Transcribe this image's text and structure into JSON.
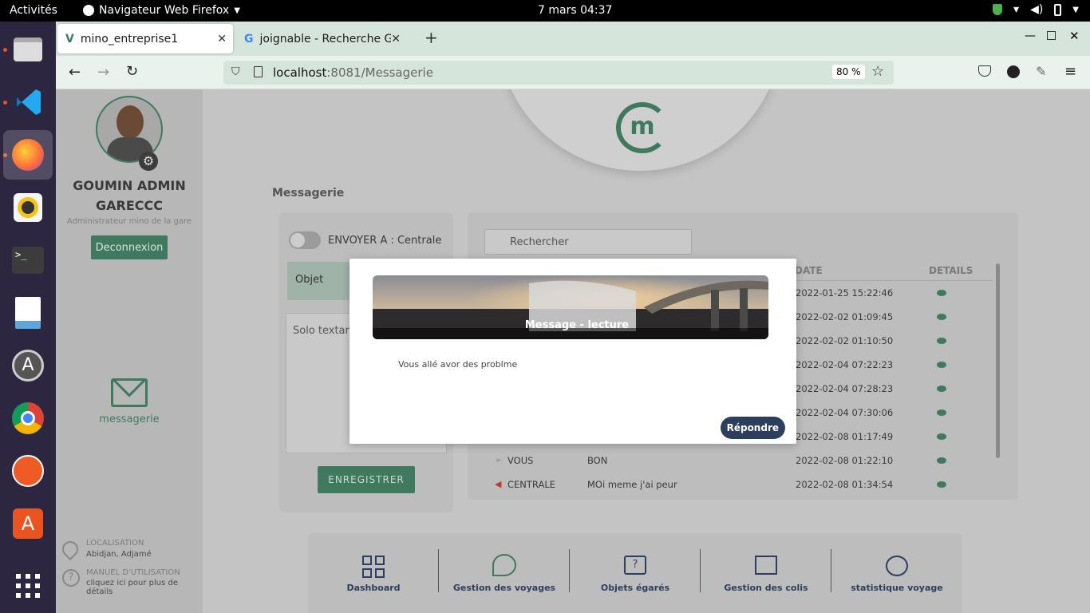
{
  "topbar": {
    "activities": "Activités",
    "app_name": "Navigateur Web Firefox",
    "clock": "7 mars  04:37"
  },
  "dock": {
    "items": [
      "files-icon",
      "vscode-icon",
      "firefox-icon",
      "rhythmbox-icon",
      "terminal-icon",
      "document-viewer-icon",
      "software-updater-icon",
      "chrome-icon",
      "postman-icon",
      "app-store-icon",
      "show-apps-icon"
    ]
  },
  "browser": {
    "tabs": [
      {
        "label": "mino_entreprise1"
      },
      {
        "label": "joignable - Recherche Go"
      }
    ],
    "new_tab": "+",
    "url_host": "localhost",
    "url_path": ":8081/Messagerie",
    "zoom": "80 %"
  },
  "sidebar": {
    "user_name": "GOUMIN ADMIN GARECCC",
    "user_role": "Administrateur mino de la gare",
    "logout": "Deconnexion",
    "nav_label": "messagerie",
    "location_title": "LOCALISATION",
    "location_value": "Abidjan, Adjamé",
    "manual_title": "MANUEL D'UTILISATION",
    "manual_value": "cliquez ici pour plus de détails"
  },
  "main": {
    "section_title": "Messagerie",
    "compose": {
      "send_to": "ENVOYER A : Centrale",
      "subject_placeholder": "Objet",
      "body_placeholder": "Solo textarea",
      "save": "ENREGISTRER"
    },
    "messages": {
      "search_placeholder": "Rechercher",
      "columns": [
        "DATE",
        "DETAILS"
      ],
      "rows": [
        {
          "from": "",
          "text": "",
          "date": "2022-01-25 15:22:46"
        },
        {
          "from": "",
          "text": "",
          "date": "2022-02-02 01:09:45"
        },
        {
          "from": "",
          "text": "",
          "date": "2022-02-02 01:10:50"
        },
        {
          "from": "",
          "text": "",
          "date": "2022-02-04 07:22:23"
        },
        {
          "from": "",
          "text": "",
          "date": "2022-02-04 07:28:23"
        },
        {
          "from": "",
          "text": "",
          "date": "2022-02-04 07:30:06"
        },
        {
          "from": "",
          "text": "",
          "date": "2022-02-08 01:17:49"
        },
        {
          "from": "VOUS",
          "text": "BON",
          "date": "2022-02-08 01:22:10"
        },
        {
          "from": "CENTRALE",
          "text": "MOi meme j'ai peur",
          "date": "2022-02-08 01:34:54"
        }
      ]
    },
    "bottom_nav": [
      {
        "label": "Dashboard",
        "icon": "dashboard-icon"
      },
      {
        "label": "Gestion des voyages",
        "icon": "voyages-icon"
      },
      {
        "label": "Objets égarés",
        "icon": "lost-items-icon"
      },
      {
        "label": "Gestion des colis",
        "icon": "parcels-icon"
      },
      {
        "label": "statistique voyage",
        "icon": "stats-icon"
      }
    ]
  },
  "modal": {
    "title": "Message - lecture",
    "body": "Vous allé avor des problme",
    "reply": "Répondre"
  },
  "colors": {
    "accent_green": "#3f7a5f",
    "modal_button": "#2d3e5e",
    "dock_bg": "#2d2640"
  }
}
